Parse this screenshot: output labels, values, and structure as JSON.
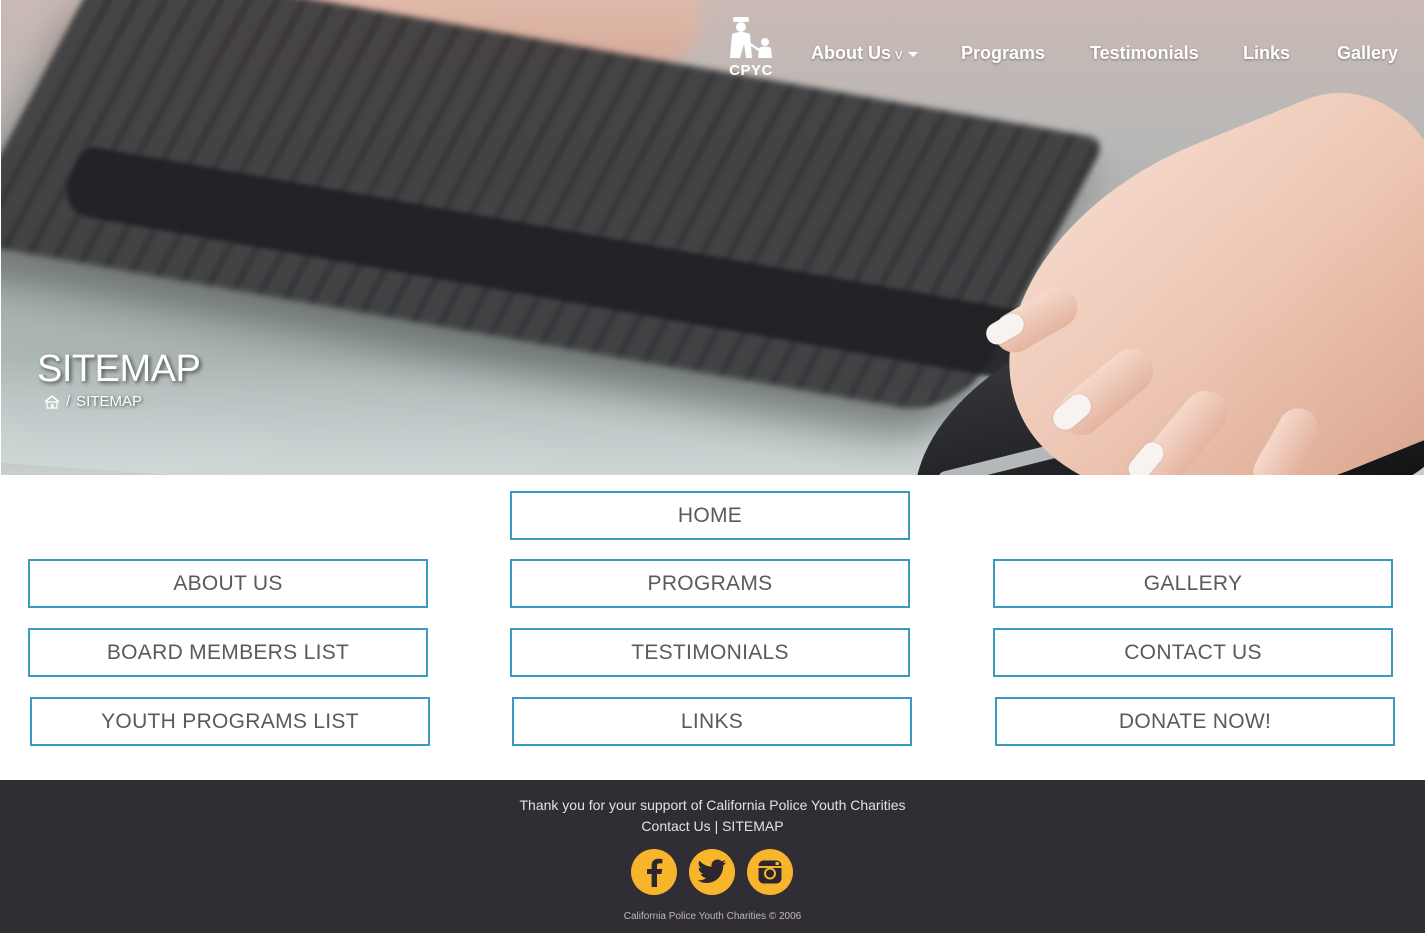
{
  "brand": {
    "logo_text": "CPYC"
  },
  "nav": {
    "about": "About Us",
    "about_caret": "v",
    "programs": "Programs",
    "testimonials": "Testimonials",
    "links": "Links",
    "gallery": "Gallery"
  },
  "hero": {
    "title": "SITEMAP",
    "breadcrumb_separator": "/",
    "breadcrumb_current": "SITEMAP"
  },
  "sitemap": {
    "home": "HOME",
    "about_us": "ABOUT US",
    "programs": "PROGRAMS",
    "gallery": "GALLERY",
    "board_members": "BOARD MEMBERS LIST",
    "testimonials": "TESTIMONIALS",
    "contact_us": "CONTACT US",
    "youth_programs": "YOUTH PROGRAMS LIST",
    "links": "LINKS",
    "donate": "DONATE NOW!"
  },
  "footer": {
    "thanks": "Thank you for your support of California Police Youth Charities",
    "contact_link": "Contact Us",
    "separator": "|",
    "sitemap_link": "SITEMAP",
    "copyright": "California Police Youth Charities © 2006",
    "social_icons": [
      "facebook-icon",
      "twitter-icon",
      "instagram-icon"
    ],
    "social_color": "#f7b52b",
    "background": "#312d34"
  },
  "colors": {
    "button_border": "#3a9bc1",
    "button_text": "#5a5a5a"
  }
}
